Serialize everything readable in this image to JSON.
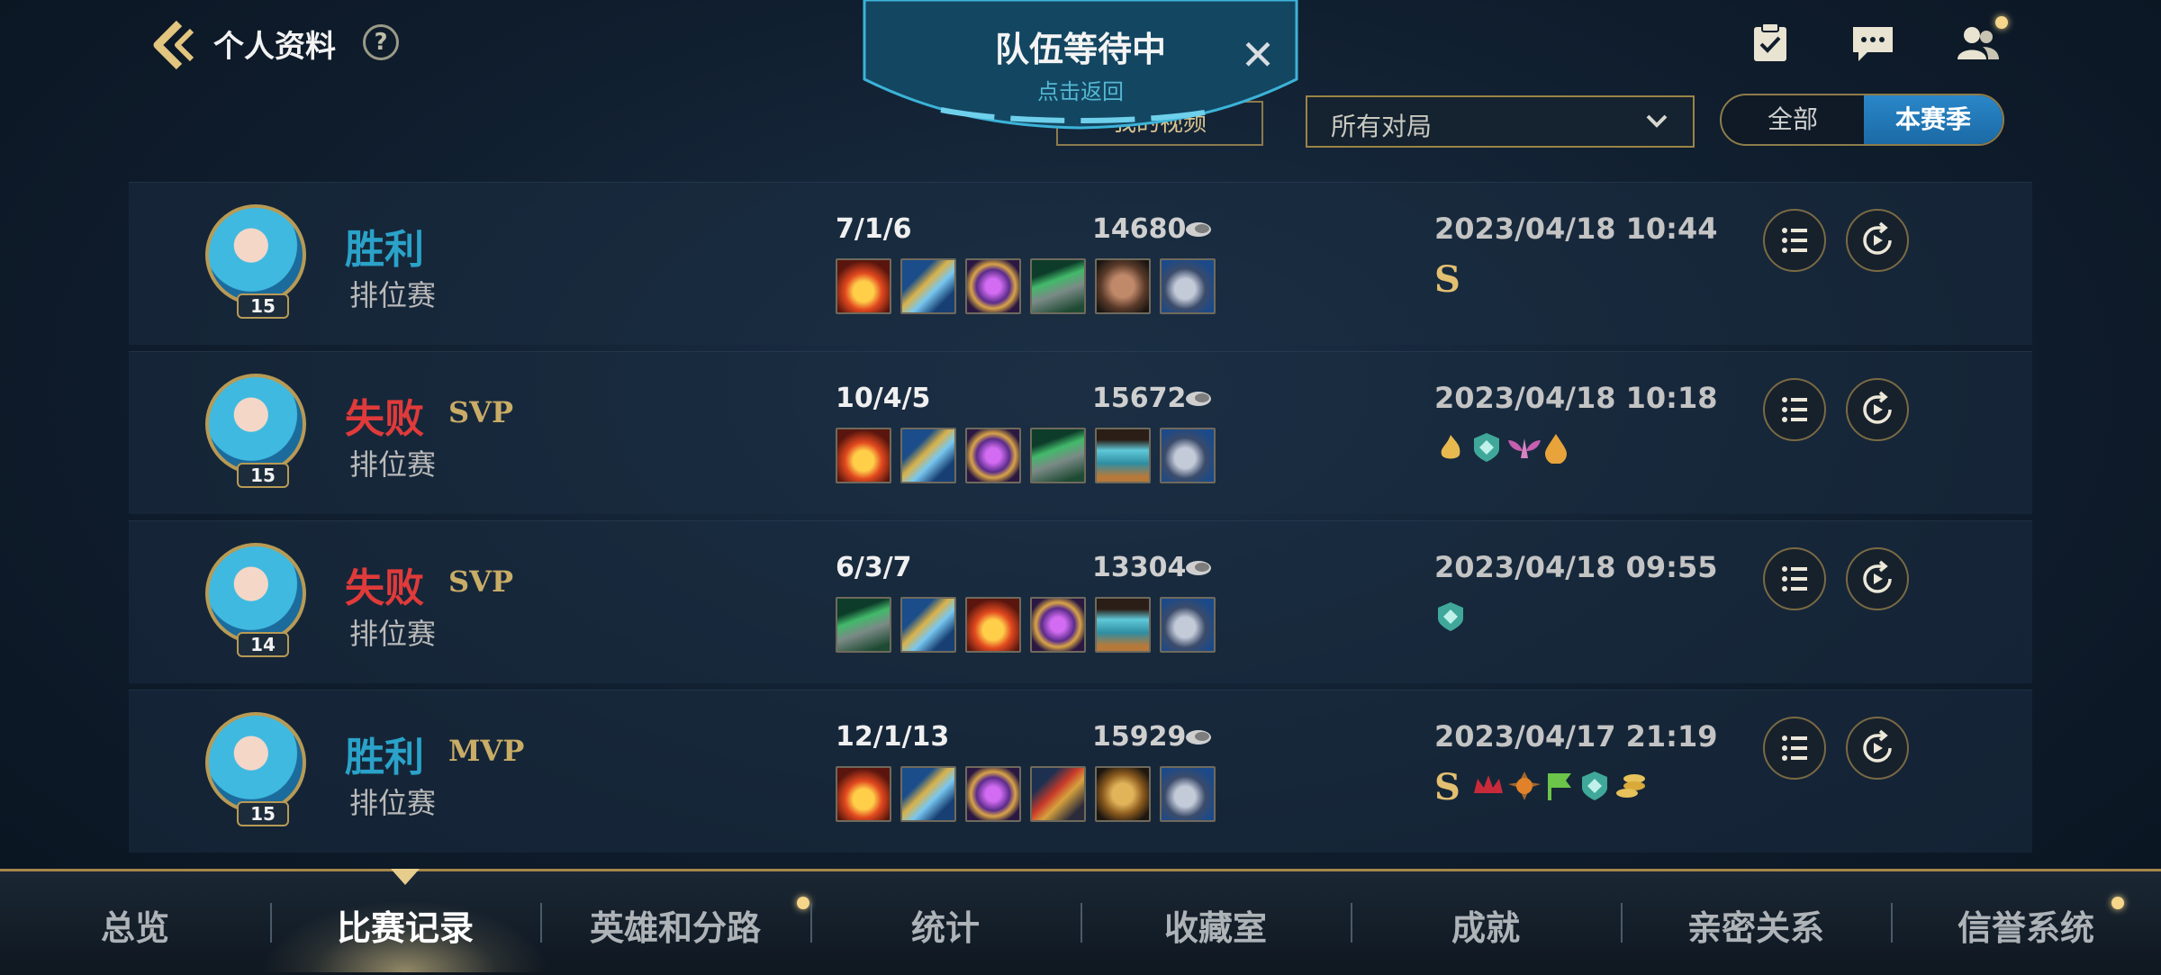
{
  "header": {
    "title": "个人资料",
    "help": "?"
  },
  "queue": {
    "title": "队伍等待中",
    "subtitle": "点击返回",
    "close": "✕"
  },
  "filters": {
    "video_button": "我的视频",
    "match_filter": "所有对局",
    "toggle": {
      "all": "全部",
      "season": "本赛季",
      "selected": "本赛季"
    }
  },
  "matches": [
    {
      "result": "胜利",
      "result_type": "win",
      "badge": "",
      "mode": "排位赛",
      "level": "15",
      "kda": "7/1/6",
      "gold": "14680",
      "date": "2023/04/18 10:44",
      "items": [
        "item-fire",
        "item-spear",
        "item-magic",
        "item-armor",
        "item-stone",
        "item-boots"
      ],
      "honors": [
        "S"
      ]
    },
    {
      "result": "失败",
      "result_type": "lose",
      "badge": "SVP",
      "mode": "排位赛",
      "level": "15",
      "kda": "10/4/5",
      "gold": "15672",
      "date": "2023/04/18 10:18",
      "items": [
        "item-fire",
        "item-spear",
        "item-magic",
        "item-armor",
        "item-shield",
        "item-boots"
      ],
      "honors": [
        "flame-honor-icon",
        "shield-honor-icon",
        "wings-honor-icon",
        "drop-honor-icon"
      ]
    },
    {
      "result": "失败",
      "result_type": "lose",
      "badge": "SVP",
      "mode": "排位赛",
      "level": "14",
      "kda": "6/3/7",
      "gold": "13304",
      "date": "2023/04/18 09:55",
      "items": [
        "item-armor",
        "item-spear",
        "item-fire",
        "item-magic",
        "item-shield",
        "item-boots"
      ],
      "honors": [
        "shield-honor-icon"
      ]
    },
    {
      "result": "胜利",
      "result_type": "win",
      "badge": "MVP",
      "mode": "排位赛",
      "level": "15",
      "kda": "12/1/13",
      "gold": "15929",
      "date": "2023/04/17 21:19",
      "items": [
        "item-fire",
        "item-spear",
        "item-magic",
        "item-axe",
        "item-gold",
        "item-boots"
      ],
      "honors": [
        "S",
        "crown-honor-icon",
        "crest-honor-icon",
        "flag-honor-icon",
        "shield-honor-icon",
        "coins-honor-icon"
      ]
    }
  ],
  "bottom_nav": [
    {
      "label": "总览",
      "active": false,
      "dot": false
    },
    {
      "label": "比赛记录",
      "active": true,
      "dot": false
    },
    {
      "label": "英雄和分路",
      "active": false,
      "dot": true
    },
    {
      "label": "统计",
      "active": false,
      "dot": false
    },
    {
      "label": "收藏室",
      "active": false,
      "dot": false
    },
    {
      "label": "成就",
      "active": false,
      "dot": false
    },
    {
      "label": "亲密关系",
      "active": false,
      "dot": false
    },
    {
      "label": "信誉系统",
      "active": false,
      "dot": true
    }
  ],
  "colors": {
    "win": "#2aa2c9",
    "lose": "#e03a3a",
    "gold_accent": "#c9ac66",
    "toggle_active": "#1f78b9"
  }
}
